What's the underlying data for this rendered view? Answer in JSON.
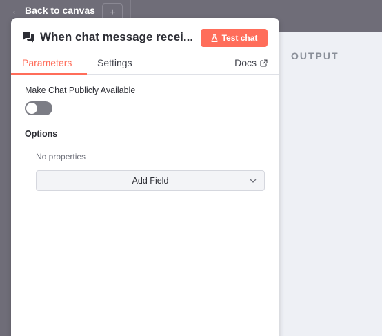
{
  "canvas": {
    "back_label": "Back to canvas",
    "plus_label": "+"
  },
  "output": {
    "title": "OUTPUT"
  },
  "node": {
    "title": "When chat message recei...",
    "test_button": "Test chat",
    "icon": "chat-bubbles-icon"
  },
  "tabs": {
    "parameters": "Parameters",
    "settings": "Settings",
    "docs": "Docs"
  },
  "parameters": {
    "public_label": "Make Chat Publicly Available",
    "public_enabled": false,
    "options_label": "Options",
    "no_properties": "No properties",
    "add_field": "Add Field"
  },
  "colors": {
    "accent": "#ff6d5a",
    "backdrop": "#6f6d78",
    "output_bg": "#eef0f5"
  }
}
